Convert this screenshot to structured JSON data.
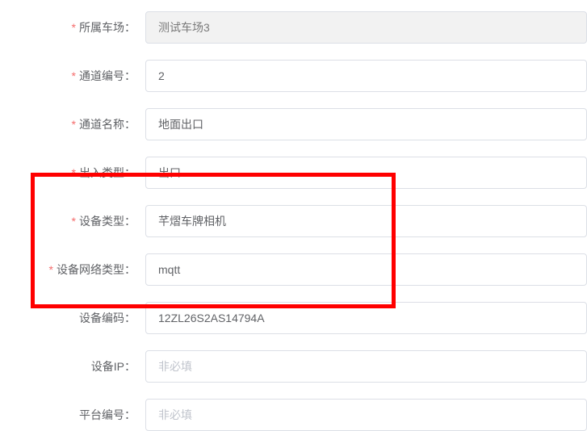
{
  "fields": {
    "parking_lot": {
      "label": "所属车场",
      "value": "测试车场3",
      "required": true,
      "readonly": true
    },
    "channel_no": {
      "label": "通道编号",
      "value": "2",
      "required": true
    },
    "channel_name": {
      "label": "通道名称",
      "value": "地面出口",
      "required": true
    },
    "io_type": {
      "label": "出入类型",
      "value": "出口",
      "required": true
    },
    "device_type": {
      "label": "设备类型",
      "value": "芊熠车牌相机",
      "required": true
    },
    "device_net_type": {
      "label": "设备网络类型",
      "value": "mqtt",
      "required": true
    },
    "device_code": {
      "label": "设备编码",
      "value": "12ZL26S2AS14794A",
      "required": false
    },
    "device_ip": {
      "label": "设备IP",
      "value": "",
      "placeholder": "非必填",
      "required": false
    },
    "platform_no": {
      "label": "平台编号",
      "value": "",
      "placeholder": "非必填",
      "required": false
    }
  },
  "separator": "："
}
